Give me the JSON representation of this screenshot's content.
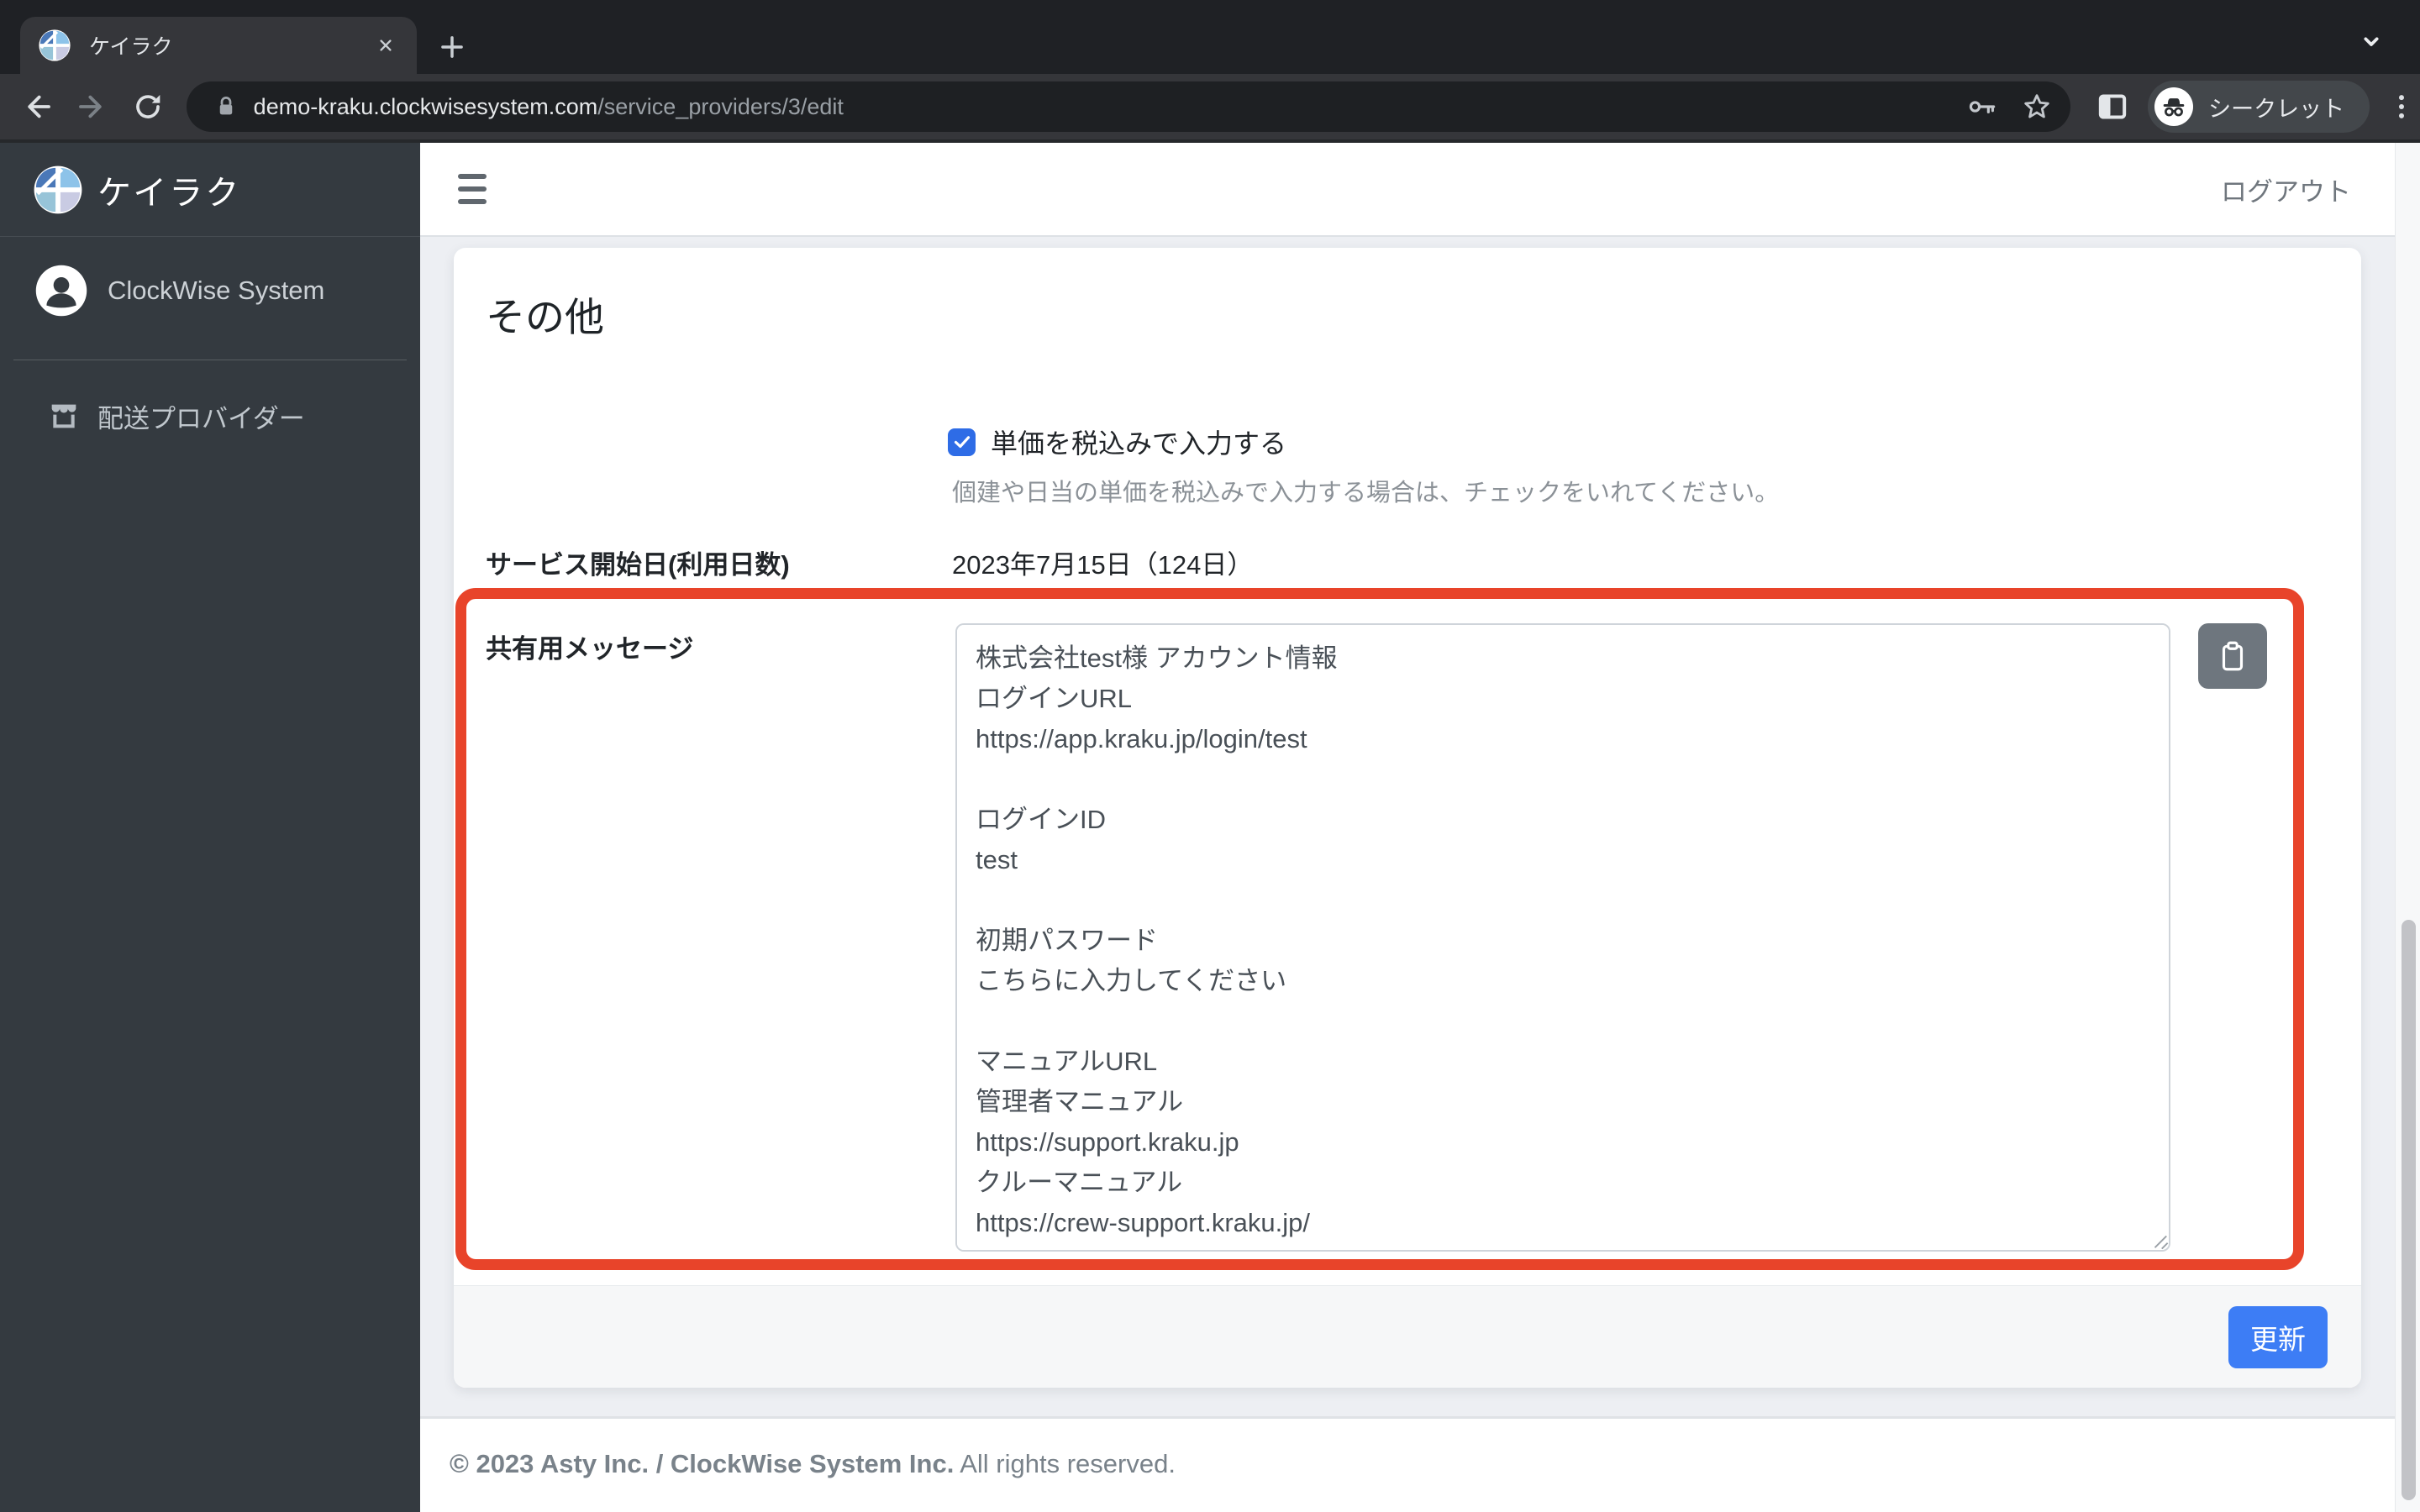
{
  "browser": {
    "tab": {
      "title": "ケイラク"
    },
    "toolbar": {
      "url_domain": "demo-kraku.clockwisesystem.com",
      "url_path": "/service_providers/3/edit",
      "incognito_label": "シークレット"
    },
    "icons": {
      "favicon": "keiraku-logo",
      "close": "close-x",
      "new_tab": "plus",
      "tab_search": "chevron-down",
      "back": "arrow-left",
      "forward": "arrow-right",
      "reload": "circular-arrow",
      "lock": "padlock",
      "key": "key",
      "bookmark": "star-outline",
      "side_panel": "split-square",
      "incognito": "hat-and-glasses",
      "menu": "three-dots-vertical"
    }
  },
  "sidebar": {
    "logo_text": "ケイラク",
    "items": [
      {
        "label": "ClockWise System",
        "icon": "person-avatar"
      },
      {
        "label": "配送プロバイダー",
        "icon": "storefront"
      }
    ]
  },
  "header": {
    "logout_label": "ログアウト"
  },
  "main": {
    "section_title": "その他",
    "tax_checkbox": {
      "checked": true,
      "label": "単価を税込みで入力する",
      "help": "個建や日当の単価を税込みで入力する場合は、チェックをいれてください。"
    },
    "service_start": {
      "label": "サービス開始日(利用日数)",
      "value": "2023年7月15日（124日）"
    },
    "shared_message": {
      "label": "共有用メッセージ",
      "value": "株式会社test様 アカウント情報\nログインURL\nhttps://app.kraku.jp/login/test\n\nログインID\ntest\n\n初期パスワード\nこちらに入力してください\n\nマニュアルURL\n管理者マニュアル\nhttps://support.kraku.jp\nクルーマニュアル\nhttps://crew-support.kraku.jp/",
      "copy_icon": "clipboard"
    },
    "submit_label": "更新"
  },
  "footer": {
    "copyright_bold": "© 2023 Asty Inc. / ClockWise System Inc.",
    "copyright_rest": " All rights reserved."
  },
  "colors": {
    "annotation_red": "#e8442a",
    "checkbox_blue": "#2e6ce6",
    "button_blue": "#3d7df5",
    "sidebar_bg": "#343a40",
    "chrome_dark": "#1f2125",
    "chrome_toolbar": "#35363a"
  }
}
